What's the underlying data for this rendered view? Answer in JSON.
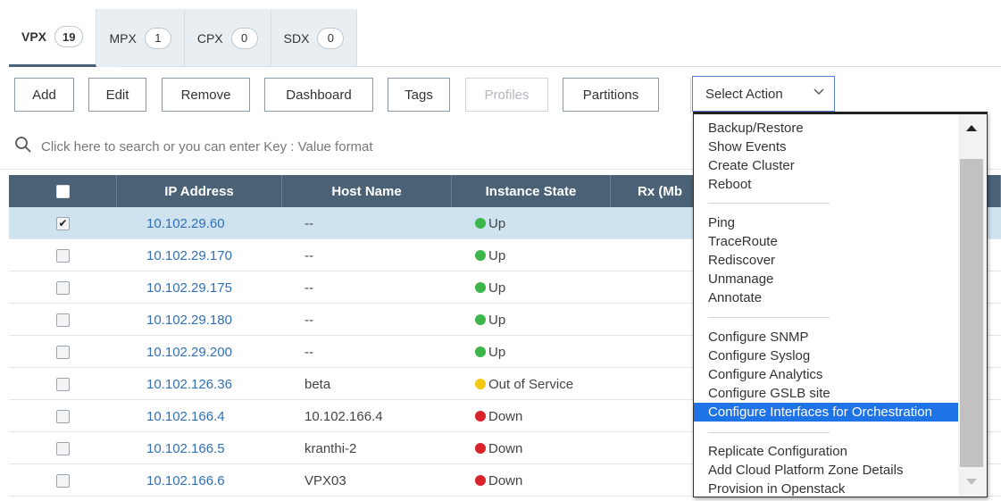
{
  "tabs": [
    {
      "label": "VPX",
      "count": "19"
    },
    {
      "label": "MPX",
      "count": "1"
    },
    {
      "label": "CPX",
      "count": "0"
    },
    {
      "label": "SDX",
      "count": "0"
    }
  ],
  "toolbar": {
    "add": "Add",
    "edit": "Edit",
    "remove": "Remove",
    "dashboard": "Dashboard",
    "tags": "Tags",
    "profiles": "Profiles",
    "partitions": "Partitions",
    "select_action": "Select Action"
  },
  "search": {
    "placeholder": "Click here to search or you can enter Key : Value format"
  },
  "table": {
    "headers": {
      "ip": "IP Address",
      "host": "Host Name",
      "state": "Instance State",
      "rx": "Rx (Mb"
    },
    "rows": [
      {
        "ip": "10.102.29.60",
        "host": "--",
        "state": "Up",
        "checked": "✔"
      },
      {
        "ip": "10.102.29.170",
        "host": "--",
        "state": "Up",
        "checked": ""
      },
      {
        "ip": "10.102.29.175",
        "host": "--",
        "state": "Up",
        "checked": ""
      },
      {
        "ip": "10.102.29.180",
        "host": "--",
        "state": "Up",
        "checked": ""
      },
      {
        "ip": "10.102.29.200",
        "host": "--",
        "state": "Up",
        "checked": ""
      },
      {
        "ip": "10.102.126.36",
        "host": "beta",
        "state": "Out of Service",
        "checked": ""
      },
      {
        "ip": "10.102.166.4",
        "host": "10.102.166.4",
        "state": "Down",
        "checked": ""
      },
      {
        "ip": "10.102.166.5",
        "host": "kranthi-2",
        "state": "Down",
        "checked": ""
      },
      {
        "ip": "10.102.166.6",
        "host": "VPX03",
        "state": "Down",
        "checked": ""
      }
    ]
  },
  "status_colors": {
    "up": "#3cb54a",
    "out_of_service": "#f2c812",
    "down": "#d8232a"
  },
  "dropdown": {
    "group1": [
      "Backup/Restore",
      "Show Events",
      "Create Cluster",
      "Reboot"
    ],
    "group2": [
      "Ping",
      "TraceRoute",
      "Rediscover",
      "Unmanage",
      "Annotate"
    ],
    "group3": [
      "Configure SNMP",
      "Configure Syslog",
      "Configure Analytics",
      "Configure GSLB site",
      "Configure Interfaces for Orchestration"
    ],
    "group4": [
      "Replicate Configuration",
      "Add Cloud Platform Zone Details",
      "Provision in Openstack"
    ],
    "highlighted": "Configure Interfaces for Orchestration"
  },
  "colors": {
    "header_bg": "#4a6176",
    "selected_row": "#cfe2ef",
    "link": "#2f70b7",
    "highlight": "#1e74e6"
  }
}
